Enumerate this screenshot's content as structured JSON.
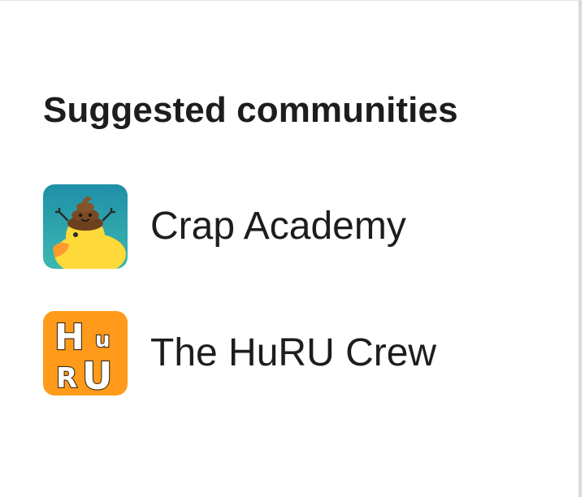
{
  "section": {
    "title": "Suggested communities"
  },
  "communities": [
    {
      "name": "Crap Academy",
      "icon": "duck-with-poop-hat-icon",
      "colors": {
        "background_top": "#1f8fa8",
        "background_bottom": "#3bb9b0",
        "duck": "#ffd83a",
        "beak": "#ff9a2e",
        "poop": "#7a4a25"
      }
    },
    {
      "name": "The HuRU Crew",
      "icon": "huru-logo-icon",
      "logo_text": "HuRU",
      "colors": {
        "background": "#ff9a1a",
        "letters": "#ffffff",
        "outline": "#3a2a1a"
      }
    }
  ]
}
